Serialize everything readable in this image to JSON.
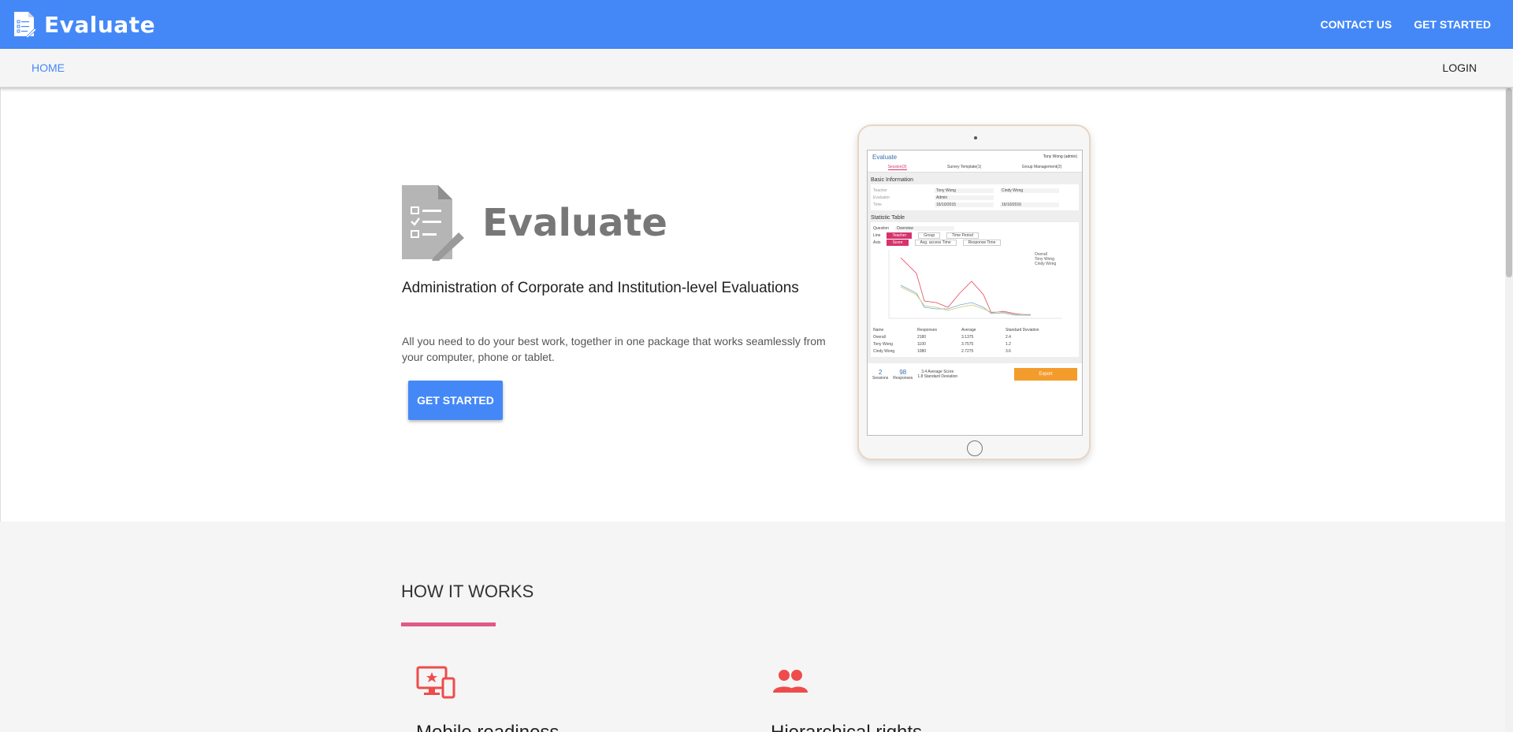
{
  "header": {
    "brand": "Evaluate",
    "links": [
      "CONTACT US",
      "GET STARTED"
    ]
  },
  "subnav": {
    "home": "HOME",
    "login": "LOGIN"
  },
  "hero": {
    "logo_text": "Evaluate",
    "title": "Administration of Corporate and Institution-level Evaluations",
    "description": "All you need to do your best work, together in one package that works seamlessly from your computer, phone or tablet.",
    "cta": "GET STARTED"
  },
  "tablet_screen": {
    "brand": "Evaluate",
    "user": "Tony Wong (admin)",
    "tabs": [
      "Session(3)",
      "Survey Template(1)",
      "Group Management(2)"
    ],
    "basic_info_title": "Basic Information",
    "info_rows": [
      {
        "label": "Teacher",
        "value1": "Tony Wong",
        "value2": "Cindy Wong"
      },
      {
        "label": "Evaluator",
        "value1": "Admin",
        "value2": ""
      },
      {
        "label": "Time",
        "value1": "16/10/2015",
        "value2": "16/10/2016"
      }
    ],
    "stat_title": "Statistic Table",
    "question_label": "Question",
    "question_value": "Overview",
    "line_label": "Line",
    "line_chips": [
      "Teacher",
      "Group",
      "Time Period"
    ],
    "axis_label": "Axis",
    "axis_chips": [
      "Score",
      "Avg. access Time",
      "Response Time"
    ],
    "legend": [
      "Overall",
      "Tony Wong",
      "Cindy Wong"
    ],
    "table_headers": [
      "Name",
      "Responses",
      "Average",
      "Standard Deviation"
    ],
    "table_rows": [
      [
        "Overall",
        "2180",
        "3.1375",
        "2.4"
      ],
      [
        "Tony Wong",
        "1100",
        "3.7575",
        "1.2"
      ],
      [
        "Cindy Wong",
        "1080",
        "2.7275",
        "3.6"
      ]
    ],
    "sessions_num": "2",
    "sessions_label": "Sessions",
    "responses_num": "98",
    "responses_label": "Responses",
    "avg_score": "3.4",
    "std_dev": "1.8",
    "avg_score_label": "Average Score",
    "std_dev_label": "Standard Deviation",
    "export": "Export"
  },
  "how_it_works": {
    "title": "HOW IT WORKS",
    "features": [
      {
        "title": "Mobile readiness",
        "icon": "devices-star-icon"
      },
      {
        "title": "Hierarchical rights",
        "icon": "people-icon"
      }
    ]
  },
  "colors": {
    "primary": "#4488f8",
    "accent": "#e05a85",
    "feature_icon": "#ef4b4b"
  }
}
